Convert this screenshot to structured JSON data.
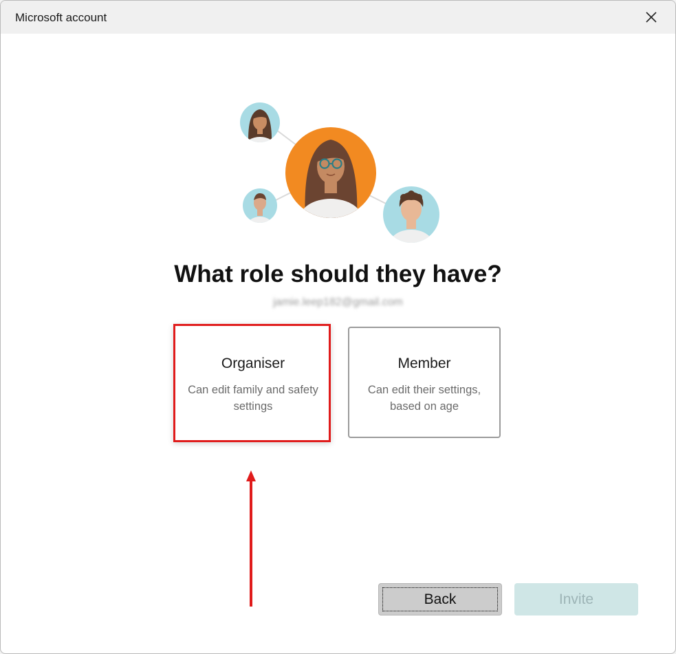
{
  "window": {
    "title": "Microsoft account"
  },
  "heading": "What role should they have?",
  "email": "jamie.leep182@gmail.com",
  "roles": [
    {
      "title": "Organiser",
      "description": "Can edit family and safety settings",
      "highlighted": true
    },
    {
      "title": "Member",
      "description": "Can edit their settings, based on age",
      "highlighted": false
    }
  ],
  "buttons": {
    "back": "Back",
    "invite": "Invite"
  },
  "colors": {
    "highlight": "#e01b1b",
    "avatar_orange": "#f28a21",
    "avatar_blue": "#a8dbe4",
    "invite_bg": "#cfe6e6"
  }
}
